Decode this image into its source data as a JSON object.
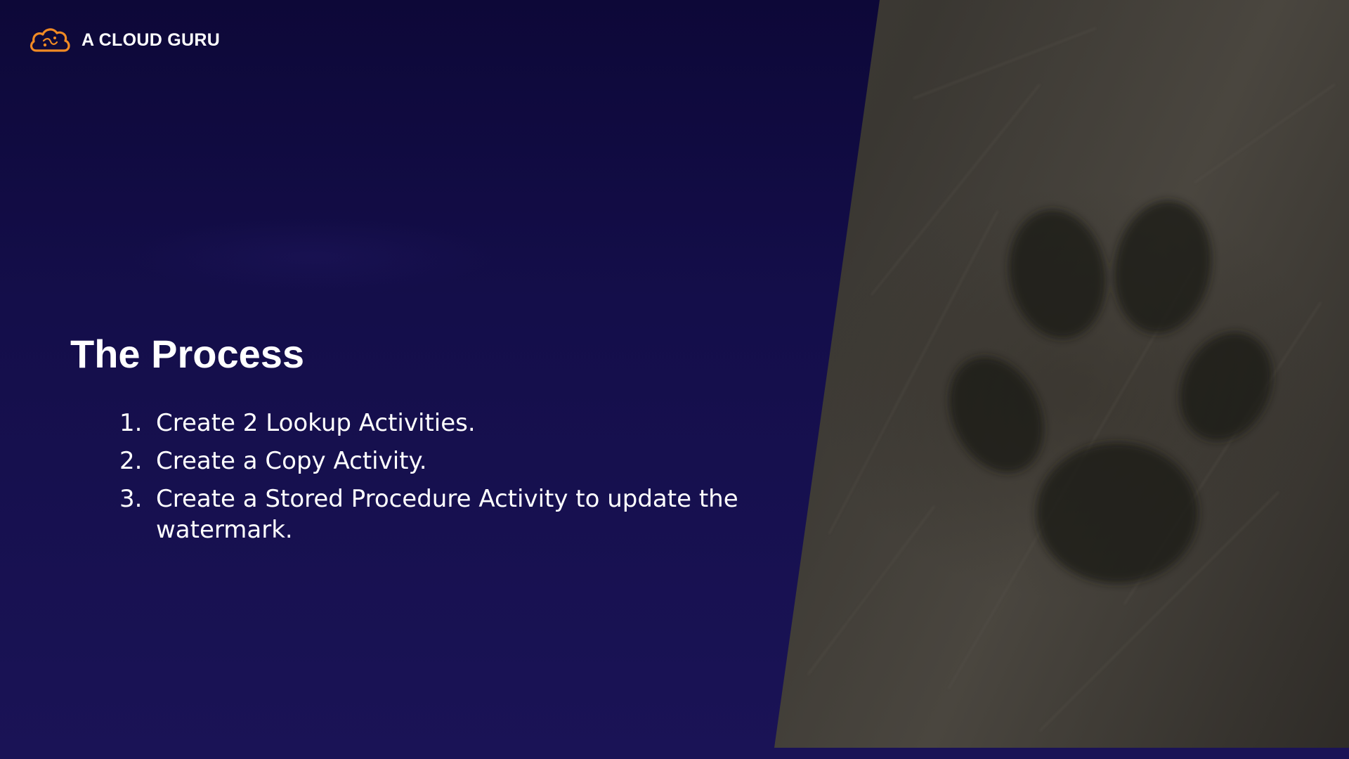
{
  "brand": {
    "name": "A CLOUD GURU",
    "icon": "cloud-logo-icon",
    "accent_color": "#f08a24"
  },
  "slide": {
    "title": "The Process",
    "steps": [
      {
        "number": "1.",
        "text": "Create 2 Lookup Activities."
      },
      {
        "number": "2.",
        "text": "Create a Copy Activity."
      },
      {
        "number": "3.",
        "text": "Create a Stored Procedure Activity to update the watermark."
      }
    ]
  },
  "colors": {
    "background_top": "#0d0838",
    "background_bottom": "#1a1356",
    "text": "#ffffff"
  },
  "image": {
    "subject": "paw-print-photo"
  }
}
